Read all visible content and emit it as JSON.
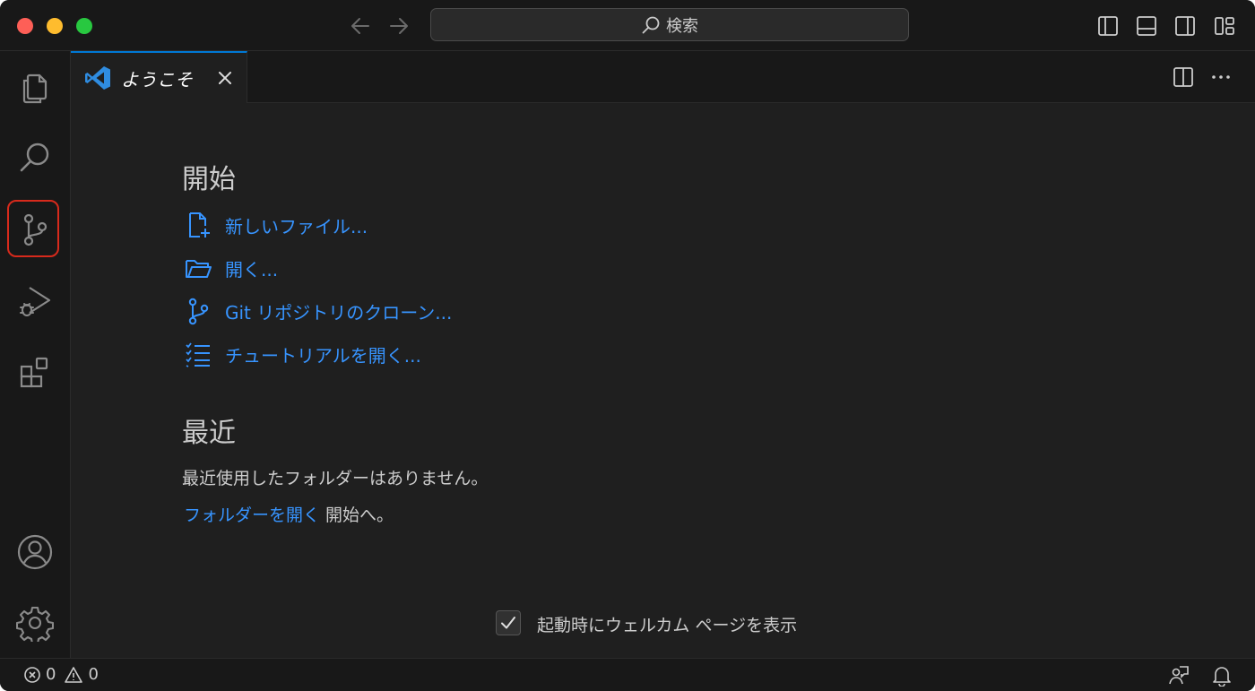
{
  "titlebar": {
    "search_placeholder": "検索",
    "icons": [
      "arrow-left-icon",
      "arrow-right-icon",
      "search-icon",
      "toggle-primary-sidebar-icon",
      "toggle-panel-icon",
      "toggle-secondary-sidebar-icon",
      "customize-layout-icon"
    ]
  },
  "activity_bar": {
    "items": [
      "explorer",
      "search",
      "source-control",
      "run-and-debug",
      "extensions"
    ],
    "bottom": [
      "accounts",
      "manage"
    ],
    "highlighted": "source-control",
    "highlight_color": "#d72a1c"
  },
  "tab": {
    "label": "ようこそ"
  },
  "welcome": {
    "start_heading": "開始",
    "start_items": [
      {
        "label": "新しいファイル...",
        "icon": "new-file-icon"
      },
      {
        "label": "開く...",
        "icon": "folder-open-icon"
      },
      {
        "label": "Git リポジトリのクローン...",
        "icon": "git-branch-icon"
      },
      {
        "label": "チュートリアルを開く...",
        "icon": "checklist-icon"
      }
    ],
    "recent_heading": "最近",
    "recent_empty": "最近使用したフォルダーはありません。",
    "open_folder_link": "フォルダーを開く",
    "open_folder_suffix": " 開始へ。",
    "show_on_startup_label": "起動時にウェルカム ページを表示",
    "show_on_startup_checked": true
  },
  "status_bar": {
    "errors": "0",
    "warnings": "0"
  },
  "colors": {
    "accent": "#0078d4",
    "link": "#3794ff",
    "background": "#1f1f1f"
  }
}
